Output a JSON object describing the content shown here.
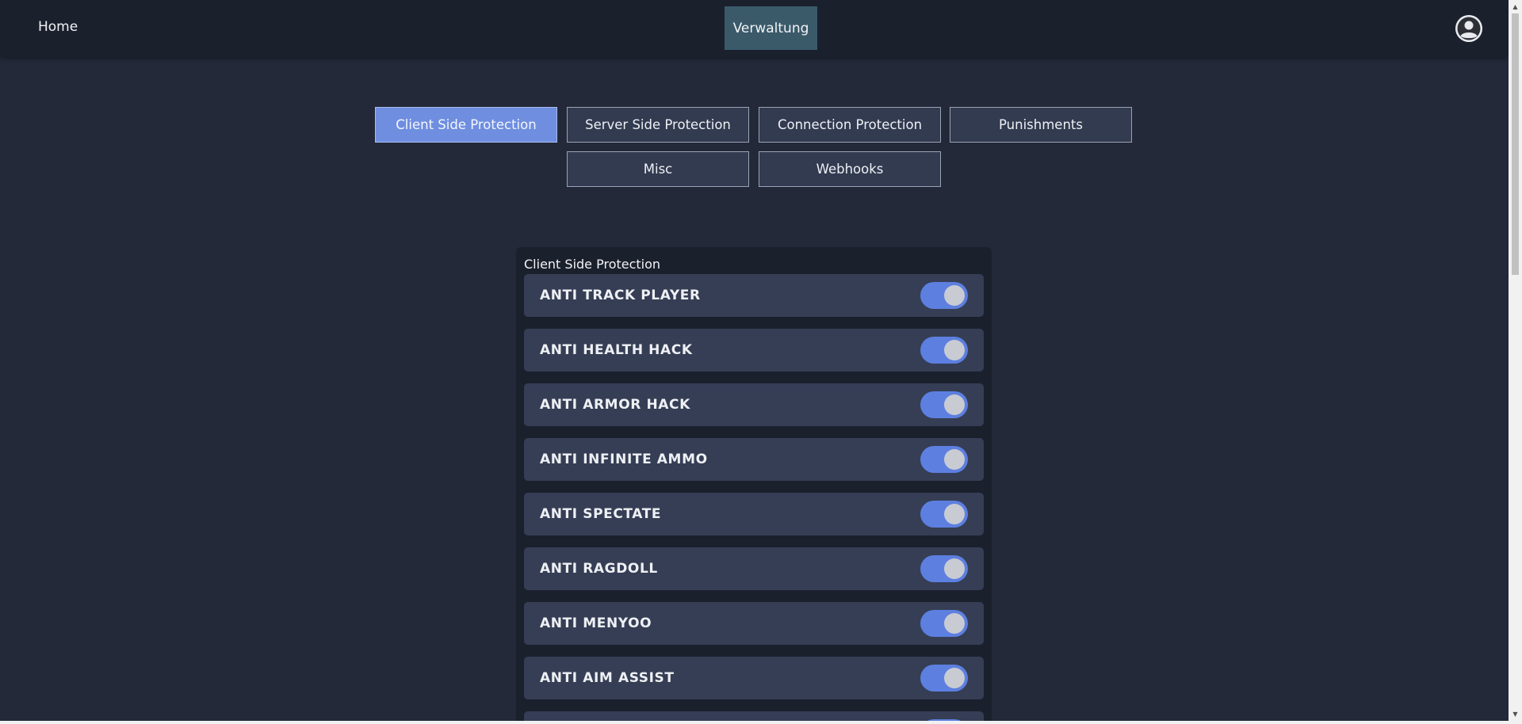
{
  "nav": {
    "home_label": "Home",
    "center_label": "Verwaltung",
    "avatar_icon": "user-avatar-icon"
  },
  "tabs": [
    {
      "label": "Client Side Protection",
      "active": true
    },
    {
      "label": "Server Side Protection",
      "active": false
    },
    {
      "label": "Connection Protection",
      "active": false
    },
    {
      "label": "Punishments",
      "active": false
    },
    {
      "label": "Misc",
      "active": false
    },
    {
      "label": "Webhooks",
      "active": false
    }
  ],
  "panel": {
    "title": "Client Side Protection",
    "items": [
      {
        "label": "ANTI TRACK PLAYER",
        "enabled": true
      },
      {
        "label": "ANTI HEALTH HACK",
        "enabled": true
      },
      {
        "label": "ANTI ARMOR HACK",
        "enabled": true
      },
      {
        "label": "ANTI INFINITE AMMO",
        "enabled": true
      },
      {
        "label": "ANTI SPECTATE",
        "enabled": true
      },
      {
        "label": "ANTI RAGDOLL",
        "enabled": true
      },
      {
        "label": "ANTI MENYOO",
        "enabled": true
      },
      {
        "label": "ANTI AIM ASSIST",
        "enabled": true
      },
      {
        "label": "",
        "enabled": true
      }
    ]
  },
  "colors": {
    "background": "#232939",
    "topbar": "#1b202d",
    "accent": "#6f8ee0",
    "toggle_on": "#5d7fe0",
    "nav_active": "#3a5a6a"
  }
}
